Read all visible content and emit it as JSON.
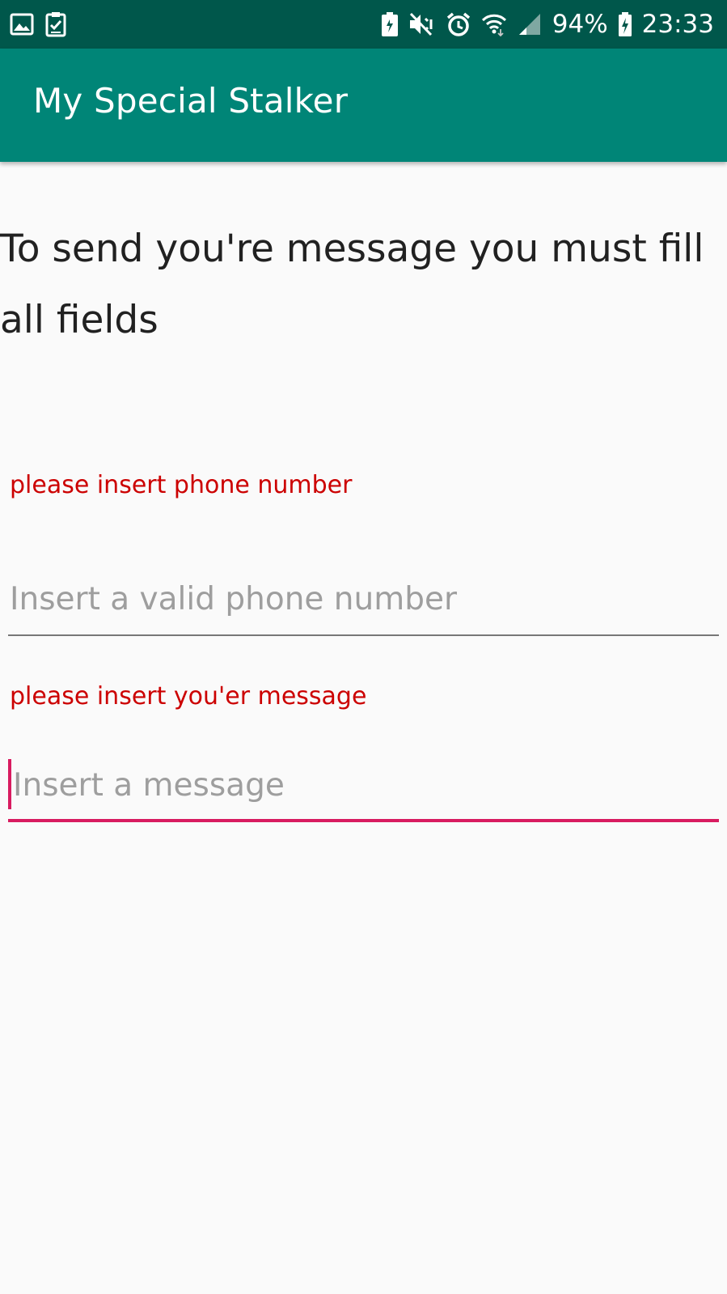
{
  "status_bar": {
    "battery_percent": "94%",
    "time": "23:33",
    "icons": [
      "gallery-icon",
      "task-check-icon",
      "battery-saver-icon",
      "mute-icon",
      "alarm-icon",
      "wifi-icon",
      "signal-icon",
      "battery-charging-icon"
    ]
  },
  "app_bar": {
    "title": "My Special Stalker"
  },
  "main": {
    "instruction": "To send you're message you must fill all fields",
    "phone": {
      "error": "please insert phone number",
      "placeholder": "Insert a valid phone number",
      "value": ""
    },
    "message": {
      "error": "please insert you'er message",
      "placeholder": "Insert a message",
      "value": ""
    }
  },
  "colors": {
    "status_bar": "#00574b",
    "app_bar": "#008577",
    "accent": "#d81b60",
    "error": "#cc0000"
  }
}
